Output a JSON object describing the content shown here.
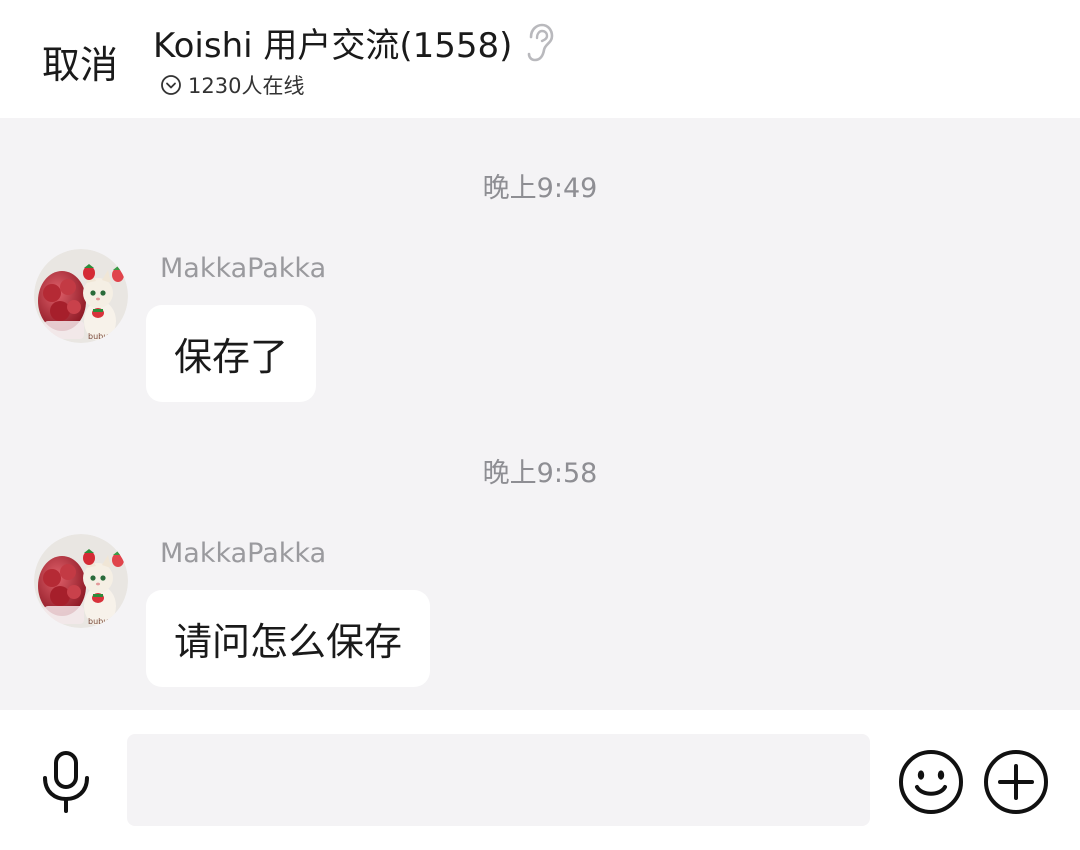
{
  "header": {
    "cancel_label": "取消",
    "title": "Koishi 用户交流(1558)",
    "online_text": "1230人在线"
  },
  "icons": {
    "ear": "ear-icon",
    "online_chevron": "chevron-down-circle-icon",
    "mic": "microphone-icon",
    "emoji": "smiley-icon",
    "plus": "plus-circle-icon"
  },
  "colors": {
    "chat_background": "#f4f3f5",
    "bubble": "#ffffff",
    "timestamp": "#8e8e93",
    "sender_name": "#9a9a9e"
  },
  "messages": [
    {
      "time": "晚上9:49",
      "sender": "MakkaPakka",
      "text": "保存了"
    },
    {
      "time": "晚上9:58",
      "sender": "MakkaPakka",
      "text": "请问怎么保存"
    }
  ],
  "composer": {
    "value": "",
    "placeholder": ""
  }
}
